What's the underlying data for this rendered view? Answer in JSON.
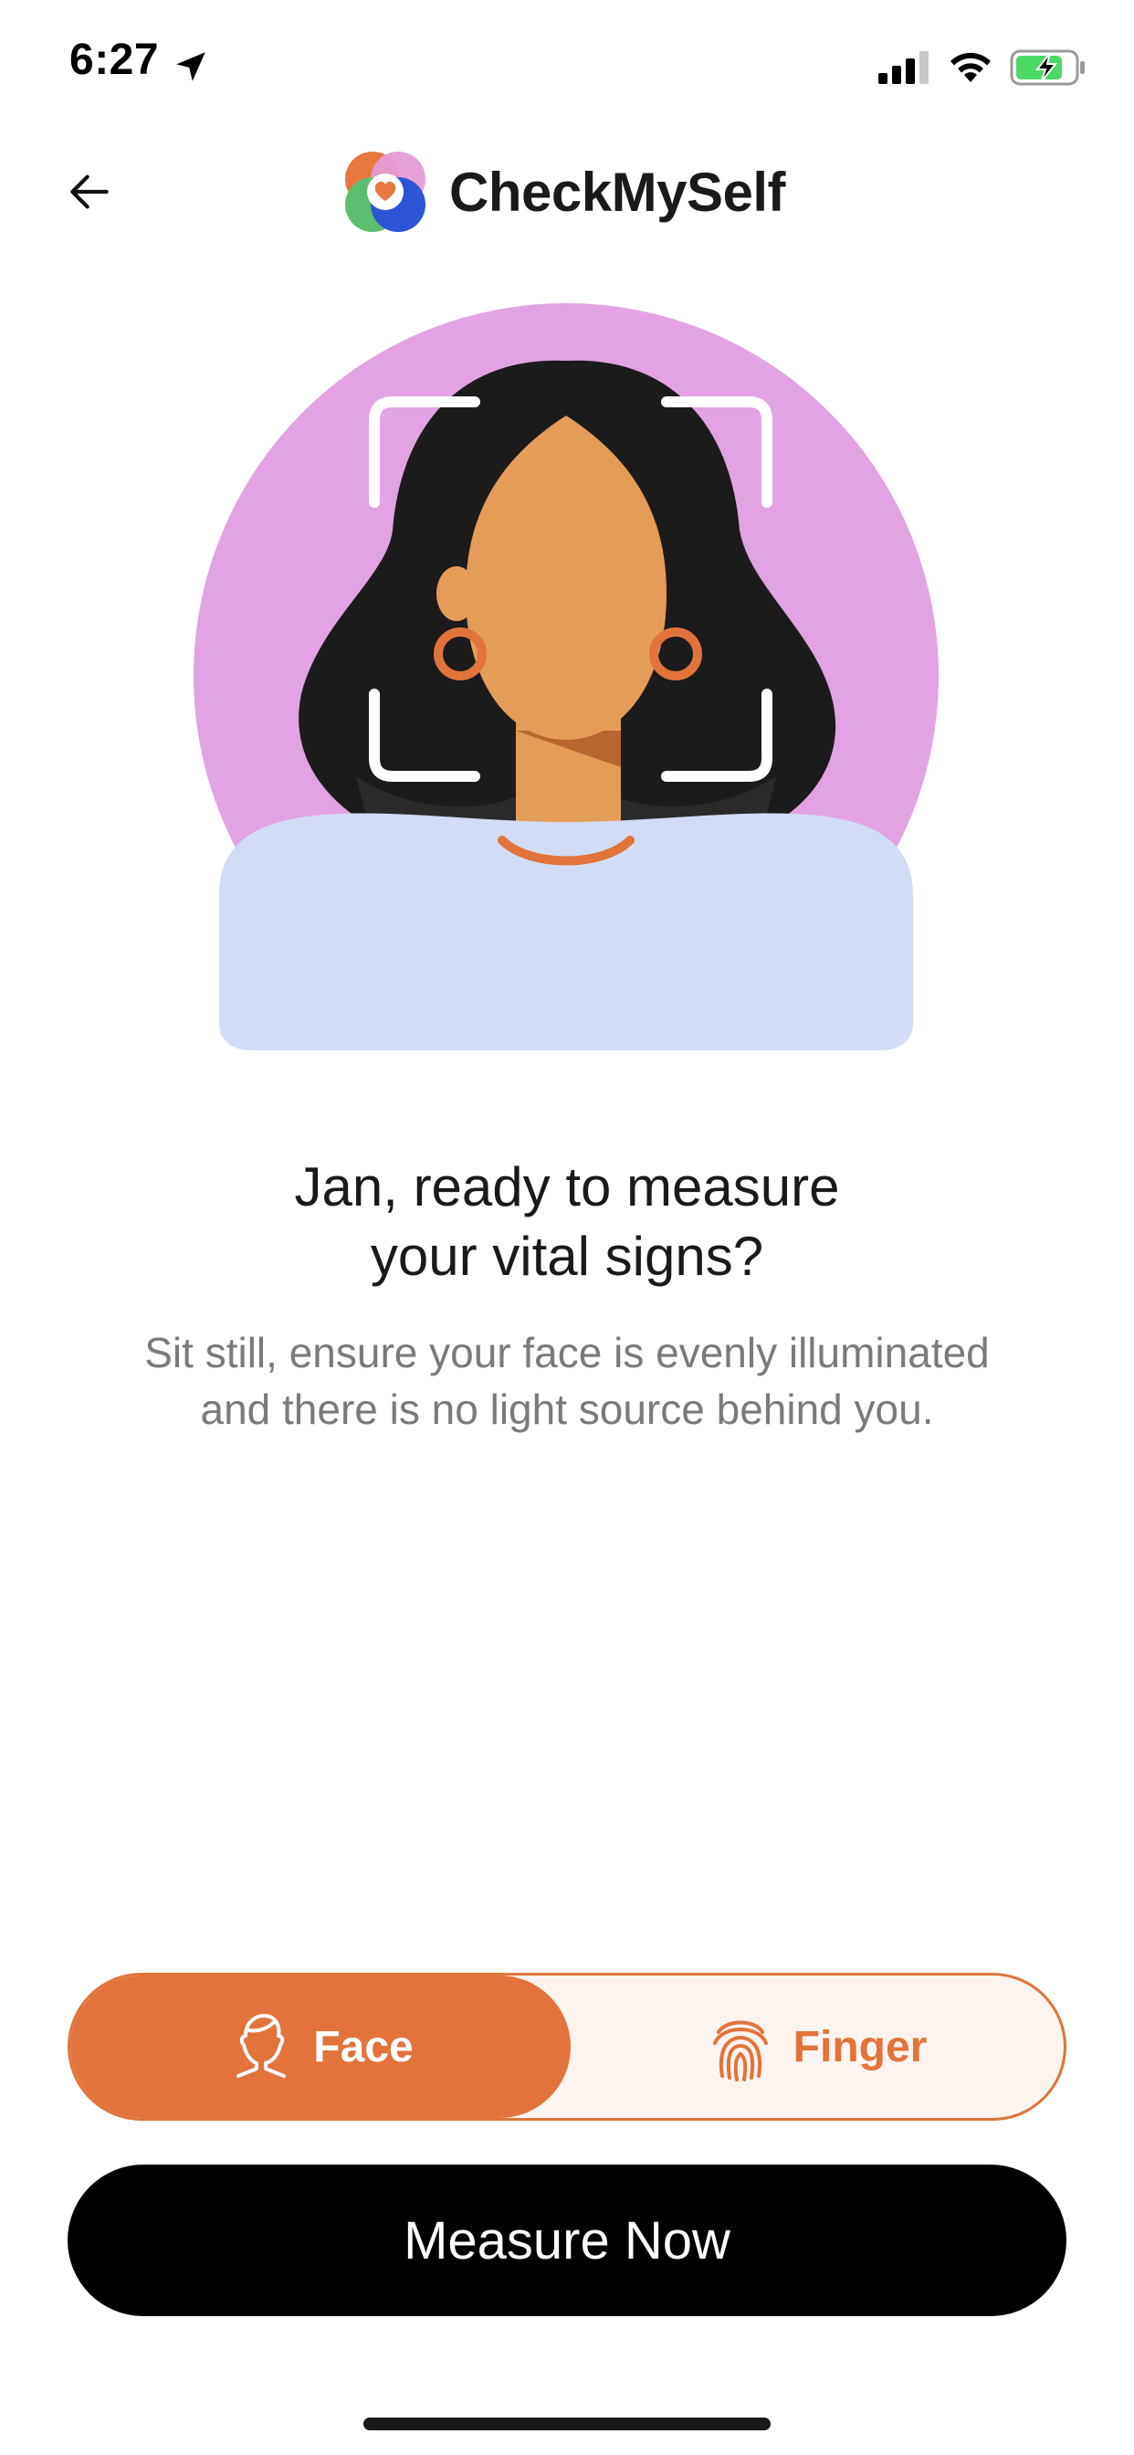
{
  "status_bar": {
    "time": "6:27",
    "icons": [
      "location-arrow-icon",
      "signal-icon",
      "wifi-icon",
      "battery-charging-icon"
    ]
  },
  "header": {
    "back_icon": "arrow-left-icon",
    "app_name": "CheckMySelf",
    "logo_colors": [
      "#e8773d",
      "#e69bd4",
      "#5cbf6f",
      "#2c55d6"
    ]
  },
  "illustration": {
    "subject": "woman-face-scan-illustration",
    "colors": {
      "circle": "#e2a3e2",
      "hair": "#1b1b1b",
      "skin": "#e59c57",
      "shirt": "#d2dcf5",
      "accent": "#e2733a",
      "frame": "#ffffff"
    }
  },
  "content": {
    "headline_line1": "Jan, ready to measure",
    "headline_line2": "your vital signs?",
    "subtext_line1": "Sit still, ensure your face is evenly illuminated",
    "subtext_line2": "and there is no light source behind you."
  },
  "mode_toggle": {
    "selected": "Face",
    "options": [
      {
        "label": "Face",
        "icon": "face-outline-icon"
      },
      {
        "label": "Finger",
        "icon": "fingerprint-icon"
      }
    ],
    "accent_color": "#e2733a"
  },
  "primary_action": {
    "label": "Measure Now",
    "background": "#000000"
  }
}
